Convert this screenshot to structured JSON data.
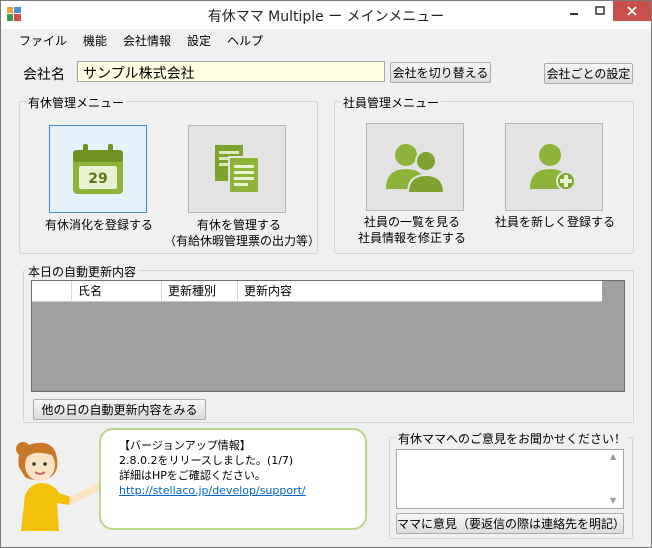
{
  "window": {
    "title": "有休ママ Multiple ー メインメニュー"
  },
  "menu": [
    "ファイル",
    "機能",
    "会社情報",
    "設定",
    "ヘルプ"
  ],
  "company": {
    "label": "会社名",
    "value": "サンプル株式会社",
    "switch_button": "会社を切り替える",
    "settings_button": "会社ごとの設定"
  },
  "yukyu_menu": {
    "title": "有休管理メニュー",
    "register_label": "有休消化を登録する",
    "calendar_day": "29",
    "manage_label_1": "有休を管理する",
    "manage_label_2": "（有給休暇管理票の出力等）"
  },
  "staff_menu": {
    "title": "社員管理メニュー",
    "list_label_1": "社員の一覧を見る",
    "list_label_2": "社員情報を修正する",
    "add_label": "社員を新しく登録する"
  },
  "auto_update": {
    "title": "本日の自動更新内容",
    "columns": [
      "",
      "氏名",
      "更新種別",
      "更新内容"
    ],
    "other_days_button": "他の日の自動更新内容をみる"
  },
  "news": {
    "heading": "【バージョンアップ情報】",
    "line1": "2.8.0.2をリリースしました。(1/7)",
    "line2": "詳細はHPをご確認ください。",
    "link": "http://stellaco.jp/develop/support/"
  },
  "feedback": {
    "title": "有休ママへのご意見をお聞かせください！",
    "button": "ママに意見（要返信の際は連絡先を明記）"
  },
  "colors": {
    "tile_icon_green": "#8db33a",
    "bubble_border": "#b7d78a",
    "close_button": "#c7504b",
    "input_background": "#ffffe1",
    "link": "#0066cc"
  }
}
